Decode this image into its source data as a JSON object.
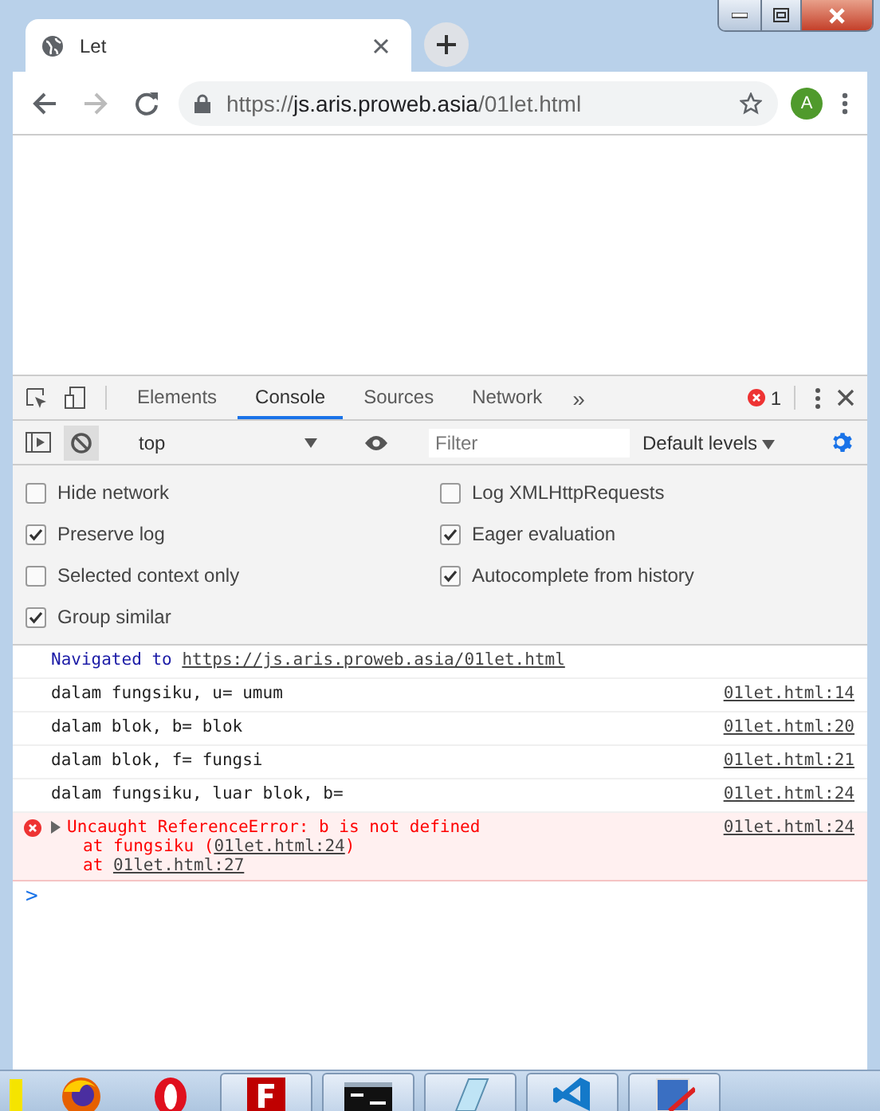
{
  "browser_tab": {
    "title": "Let",
    "selected": true
  },
  "address_bar": {
    "scheme": "https://",
    "host": "js.aris.proweb.asia",
    "path": "/01let.html"
  },
  "profile": {
    "initial": "A"
  },
  "devtools": {
    "tabs": [
      {
        "label": "Elements",
        "selected": false
      },
      {
        "label": "Console",
        "selected": true
      },
      {
        "label": "Sources",
        "selected": false
      },
      {
        "label": "Network",
        "selected": false
      }
    ],
    "more_tabs": "»",
    "error_count": "1",
    "context": "top",
    "filter": {
      "placeholder": "Filter"
    },
    "levels": "Default levels",
    "settings_left": [
      {
        "label": "Hide network",
        "checked": false
      },
      {
        "label": "Preserve log",
        "checked": true
      },
      {
        "label": "Selected context only",
        "checked": false
      },
      {
        "label": "Group similar",
        "checked": true
      }
    ],
    "settings_right": [
      {
        "label": "Log XMLHttpRequests",
        "checked": false
      },
      {
        "label": "Eager evaluation",
        "checked": true
      },
      {
        "label": "Autocomplete from history",
        "checked": true
      }
    ],
    "messages": [
      {
        "kind": "nav",
        "text": "Navigated to",
        "link": "https://js.aris.proweb.asia/01let.html"
      },
      {
        "kind": "log",
        "text": "dalam fungsiku, u= umum",
        "source": "01let.html:14"
      },
      {
        "kind": "log",
        "text": "dalam blok, b= blok",
        "source": "01let.html:20"
      },
      {
        "kind": "log",
        "text": "dalam blok, f= fungsi",
        "source": "01let.html:21"
      },
      {
        "kind": "log",
        "text": "dalam fungsiku, luar blok, b=",
        "source": "01let.html:24"
      },
      {
        "kind": "error",
        "text": "Uncaught ReferenceError: b is not defined",
        "source": "01let.html:24",
        "stack": [
          {
            "prefix": "at fungsiku (",
            "link": "01let.html:24",
            "suffix": ")"
          },
          {
            "prefix": "at ",
            "link": "01let.html:27"
          }
        ]
      }
    ],
    "prompt": ">"
  },
  "taskbar": [
    {
      "kind": "yellow",
      "running": false
    },
    {
      "kind": "firefox",
      "running": false
    },
    {
      "kind": "opera",
      "running": false
    },
    {
      "kind": "filezilla",
      "running": true
    },
    {
      "kind": "cmd",
      "running": true
    },
    {
      "kind": "notepad",
      "running": true
    },
    {
      "kind": "vscode",
      "running": true
    },
    {
      "kind": "paint",
      "running": true
    }
  ]
}
